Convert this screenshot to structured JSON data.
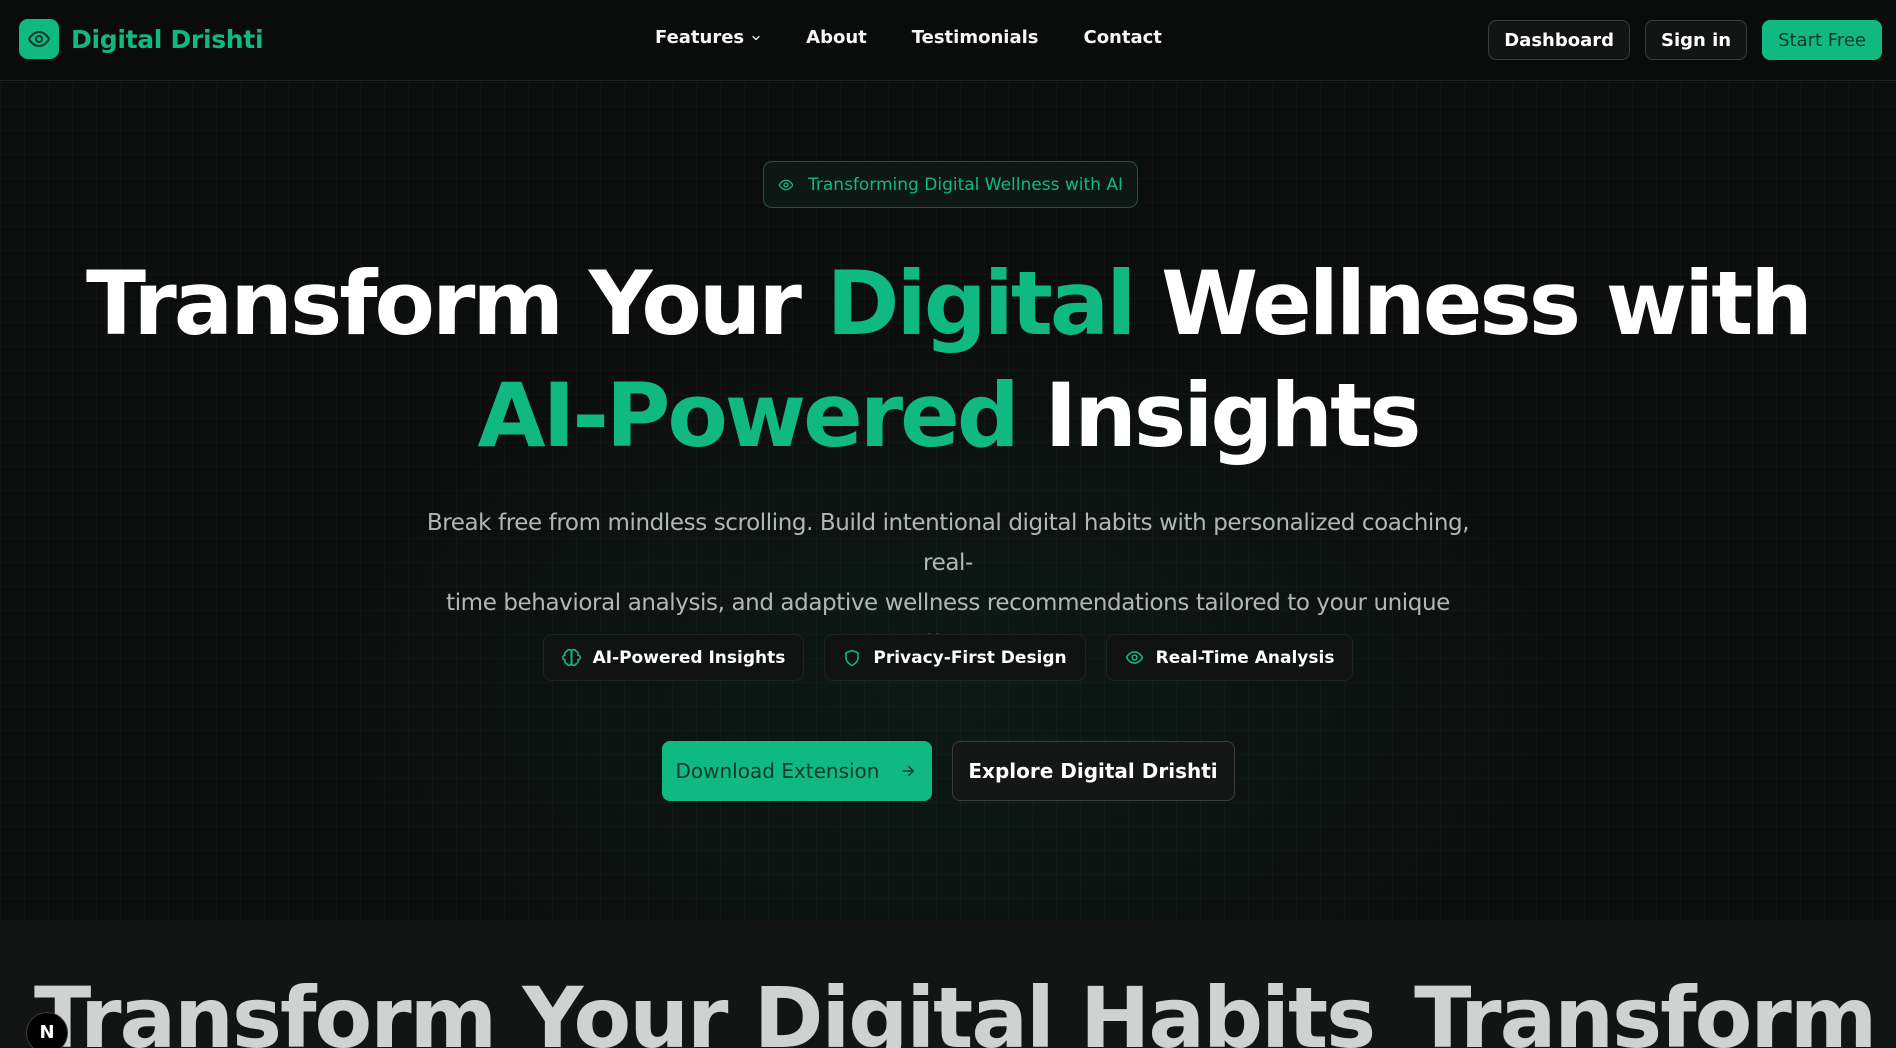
{
  "header": {
    "logo_text": "Digital Drishti",
    "logo_icon": "eye-icon",
    "nav": {
      "features": "Features",
      "about": "About",
      "testimonials": "Testimonials",
      "contact": "Contact"
    },
    "actions": {
      "dashboard": "Dashboard",
      "sign_in": "Sign in",
      "start_free": "Start Free"
    }
  },
  "hero": {
    "pill": "Transforming Digital Wellness with AI",
    "headline": {
      "part1": "Transform Your ",
      "part2_green": "Digital",
      "part3": " Wellness with",
      "part4_green": "AI-Powered",
      "part5": " Insights"
    },
    "subtitle_line1": "Break free from mindless scrolling. Build intentional digital habits with personalized coaching, real-",
    "subtitle_line2": "time behavioral analysis, and adaptive wellness recommendations tailored to your unique patterns.",
    "chips": [
      {
        "label": "AI-Powered Insights",
        "icon": "brain-icon"
      },
      {
        "label": "Privacy-First Design",
        "icon": "shield-icon"
      },
      {
        "label": "Real-Time Analysis",
        "icon": "eye-icon"
      }
    ],
    "cta_primary": "Download Extension",
    "cta_secondary": "Explore Digital Drishti"
  },
  "marquee": {
    "items": [
      "Transform Your Digital Habits",
      "Transform Your Digital Habits"
    ]
  },
  "corner_badge": "N",
  "colors": {
    "accent": "#10b981",
    "background": "#0b0c0c",
    "text": "#ffffff",
    "muted": "#b3b8b6"
  }
}
